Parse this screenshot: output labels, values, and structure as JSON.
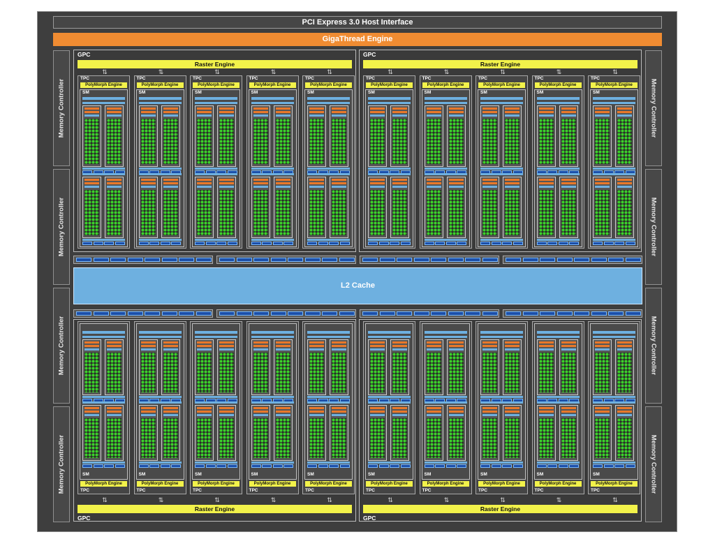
{
  "header": {
    "pcie": "PCI Express 3.0 Host Interface",
    "giga": "GigaThread Engine"
  },
  "memory_controller_label": "Memory Controller",
  "l2": "L2 Cache",
  "gpc": {
    "label": "GPC",
    "raster": "Raster Engine"
  },
  "tpc": {
    "label": "TPC",
    "poly": "PolyMorph Engine",
    "sm": "SM"
  },
  "colors": {
    "chip": "#3e3e3e",
    "giga": "#f08c32",
    "raster": "#f2f24a",
    "cache": "#6eb0e0",
    "dispatch": "#1c4fa8",
    "core": "#3bd22a",
    "orange": "#e8782a"
  }
}
